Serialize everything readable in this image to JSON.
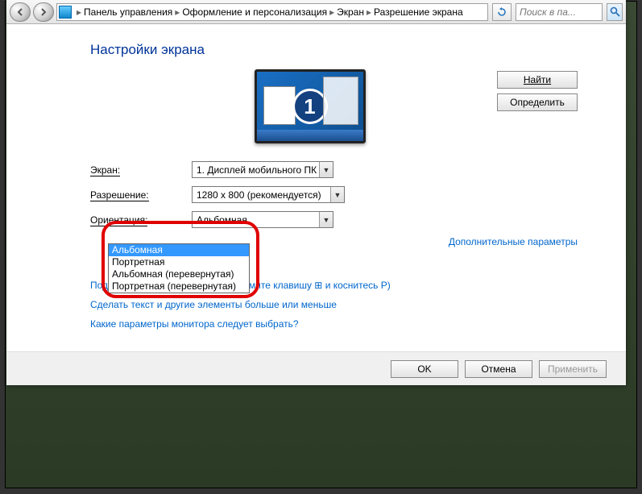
{
  "breadcrumb": {
    "items": [
      "Панель управления",
      "Оформление и персонализация",
      "Экран",
      "Разрешение экрана"
    ]
  },
  "search": {
    "placeholder": "Поиск в па..."
  },
  "title": "Настройки экрана",
  "monitor_number": "1",
  "side_buttons": {
    "find": "Найти",
    "detect": "Определить"
  },
  "labels": {
    "display": "Экран:",
    "resolution": "Разрешение:",
    "orientation": "Ориентация:"
  },
  "display_combo": "1. Дисплей мобильного ПК",
  "resolution_combo": "1280 x 800 (рекомендуется)",
  "orientation_combo": "Альбомная",
  "orientation_options": [
    "Альбомная",
    "Портретная",
    "Альбомная (перевернутая)",
    "Портретная (перевернутая)"
  ],
  "advanced_link": "Дополнительные параметры",
  "links": {
    "projector": "Подключение к проектору (или нажмите клавишу ⊞ и коснитесь P)",
    "textsize": "Сделать текст и другие элементы больше или меньше",
    "which": "Какие параметры монитора следует выбрать?"
  },
  "buttons": {
    "ok": "OK",
    "cancel": "Отмена",
    "apply": "Применить"
  }
}
